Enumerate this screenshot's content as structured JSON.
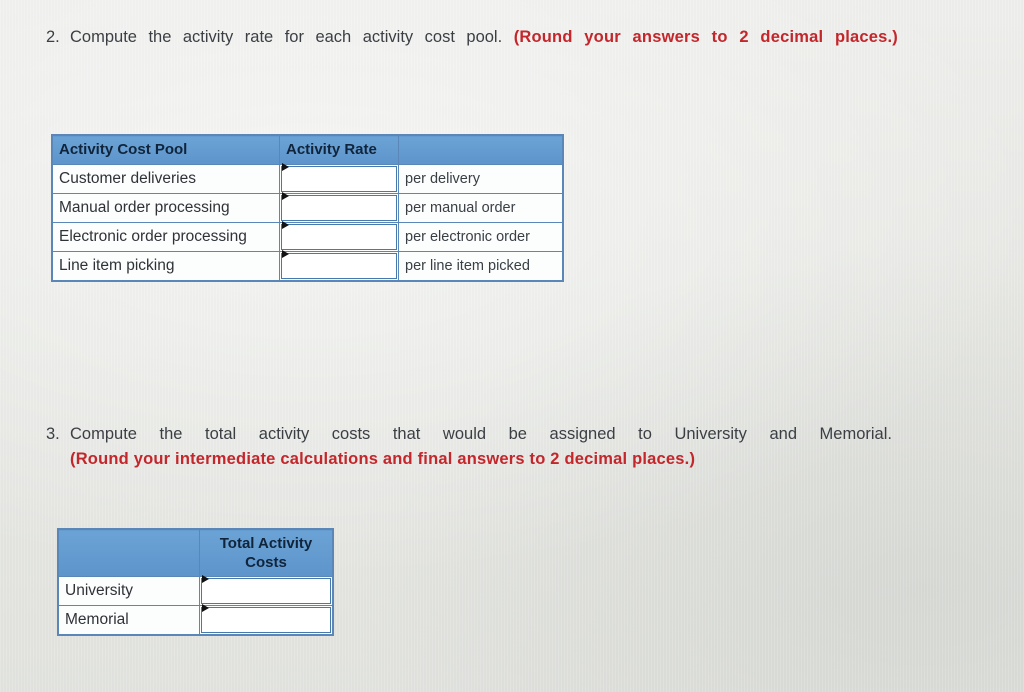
{
  "questions": [
    {
      "number": "2.",
      "text": "Compute the activity rate for each activity cost pool.",
      "hint": "(Round your answers to 2 decimal places.)"
    },
    {
      "number": "3.",
      "text": "Compute the total activity costs that would be assigned to University and Memorial.",
      "hint": "(Round your intermediate calculations and final answers to 2 decimal places.)"
    }
  ],
  "activity_rate_table": {
    "headers": [
      "Activity Cost Pool",
      "Activity Rate",
      ""
    ],
    "rows": [
      {
        "pool": "Customer deliveries",
        "rate": "",
        "unit": "per delivery"
      },
      {
        "pool": "Manual order processing",
        "rate": "",
        "unit": "per manual order"
      },
      {
        "pool": "Electronic order processing",
        "rate": "",
        "unit": "per electronic order"
      },
      {
        "pool": "Line item picking",
        "rate": "",
        "unit": "per line item picked"
      }
    ]
  },
  "total_cost_table": {
    "headers": [
      "",
      "Total Activity Costs"
    ],
    "header_line1": "Total Activity",
    "header_line2": "Costs",
    "rows": [
      {
        "name": "University",
        "cost": ""
      },
      {
        "name": "Memorial",
        "cost": ""
      }
    ]
  },
  "colors": {
    "hint": "#c3262b",
    "header_blue": "#6ba3d6",
    "border_blue": "#5b86b8",
    "text": "#3b3f44"
  }
}
